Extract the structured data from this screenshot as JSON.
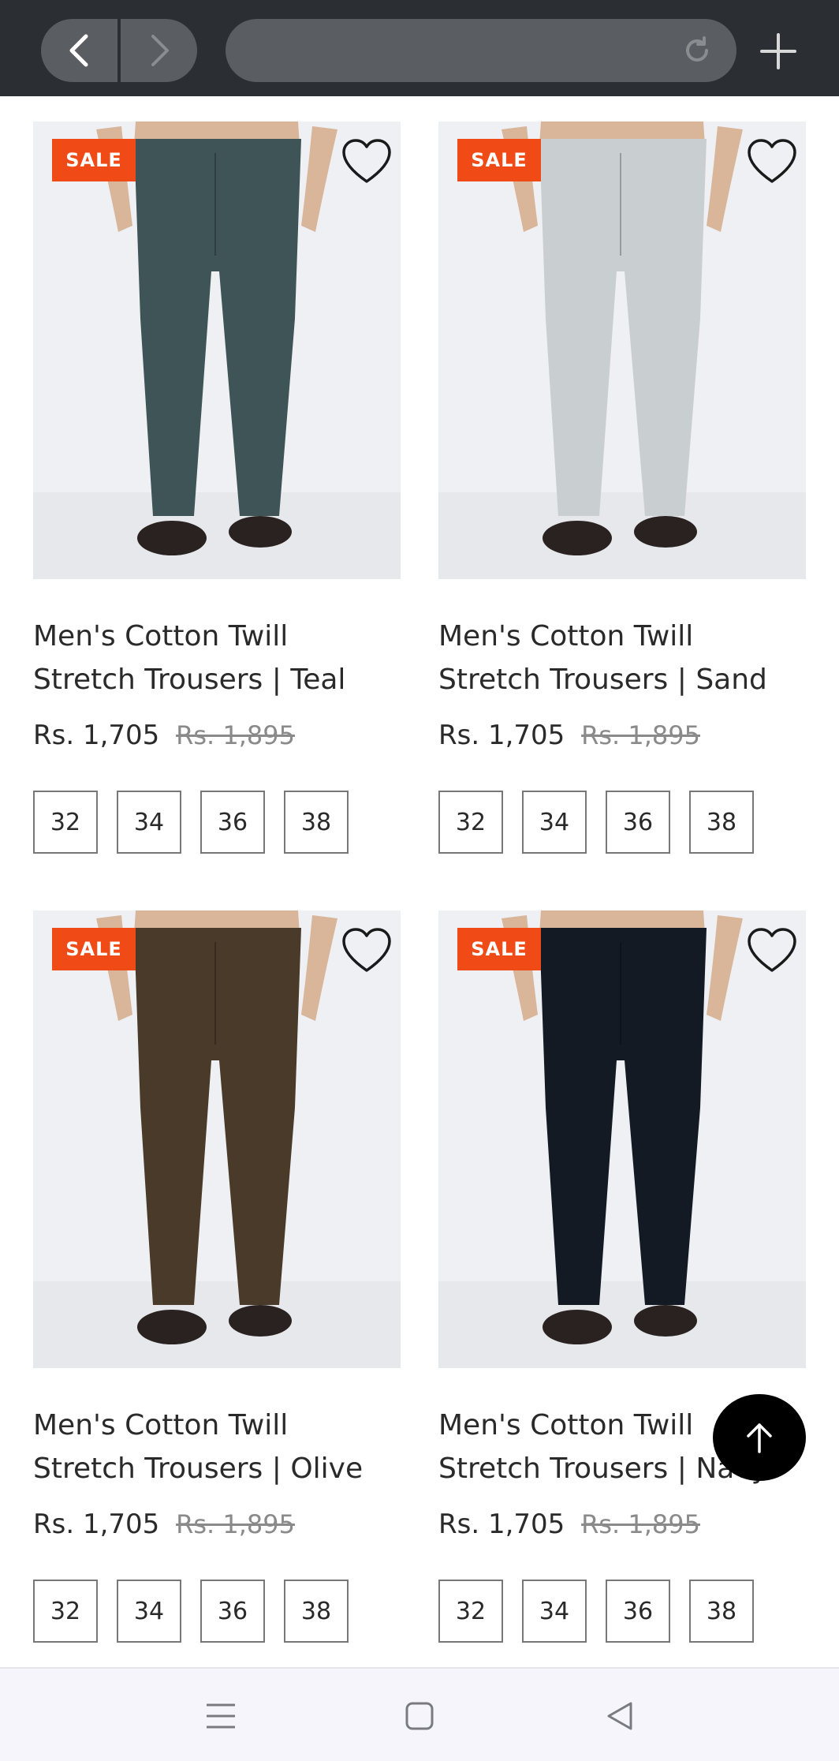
{
  "browser": {
    "back_icon": "chevron-left-icon",
    "forward_icon": "chevron-right-icon",
    "reload_icon": "reload-icon",
    "new_tab_icon": "plus-icon",
    "url": ""
  },
  "products": [
    {
      "badge": "SALE",
      "title_line1": "Men's Cotton Twill",
      "title_line2": "Stretch Trousers | Teal",
      "price": "Rs. 1,705",
      "old_price": "Rs. 1,895",
      "sizes": [
        "32",
        "34",
        "36",
        "38"
      ],
      "color": "#3f5457"
    },
    {
      "badge": "SALE",
      "title_line1": "Men's Cotton Twill",
      "title_line2": "Stretch Trousers | Sand",
      "price": "Rs. 1,705",
      "old_price": "Rs. 1,895",
      "sizes": [
        "32",
        "34",
        "36",
        "38"
      ],
      "color": "#c9cfd0"
    },
    {
      "badge": "SALE",
      "title_line1": "Men's Cotton Twill",
      "title_line2": "Stretch Trousers | Olive",
      "price": "Rs. 1,705",
      "old_price": "Rs. 1,895",
      "sizes": [
        "32",
        "34",
        "36",
        "38"
      ],
      "color": "#4a3a2a"
    },
    {
      "badge": "SALE",
      "title_line1": "Men's Cotton Twill",
      "title_line2": "Stretch Trousers | Navy",
      "price": "Rs. 1,705",
      "old_price": "Rs. 1,895",
      "sizes": [
        "32",
        "34",
        "36",
        "38"
      ],
      "color": "#131a24"
    }
  ],
  "scroll_top_icon": "arrow-up-icon",
  "system_nav": {
    "menu_icon": "menu-icon",
    "home_icon": "home-square-icon",
    "back_icon": "back-triangle-icon"
  },
  "colors": {
    "sale_badge": "#f04a17",
    "toolbar": "#2b2f33"
  }
}
